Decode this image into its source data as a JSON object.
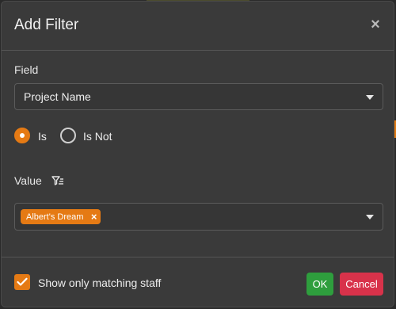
{
  "dialog": {
    "title": "Add Filter",
    "close_symbol": "×"
  },
  "field": {
    "label": "Field",
    "selected": "Project Name"
  },
  "operator": {
    "options": [
      {
        "label": "Is",
        "checked": true
      },
      {
        "label": "Is Not",
        "checked": false
      }
    ]
  },
  "value": {
    "label": "Value",
    "icon": "filter-list-icon",
    "chips": [
      {
        "label": "Albert's Dream",
        "remove_symbol": "×"
      }
    ]
  },
  "footer": {
    "checkbox_label": "Show only matching staff",
    "checkbox_checked": true,
    "ok_label": "OK",
    "cancel_label": "Cancel"
  },
  "colors": {
    "accent": "#e57a14",
    "ok": "#2e9e3d",
    "cancel": "#d8324a",
    "dialog_bg": "#3a3a3a"
  }
}
